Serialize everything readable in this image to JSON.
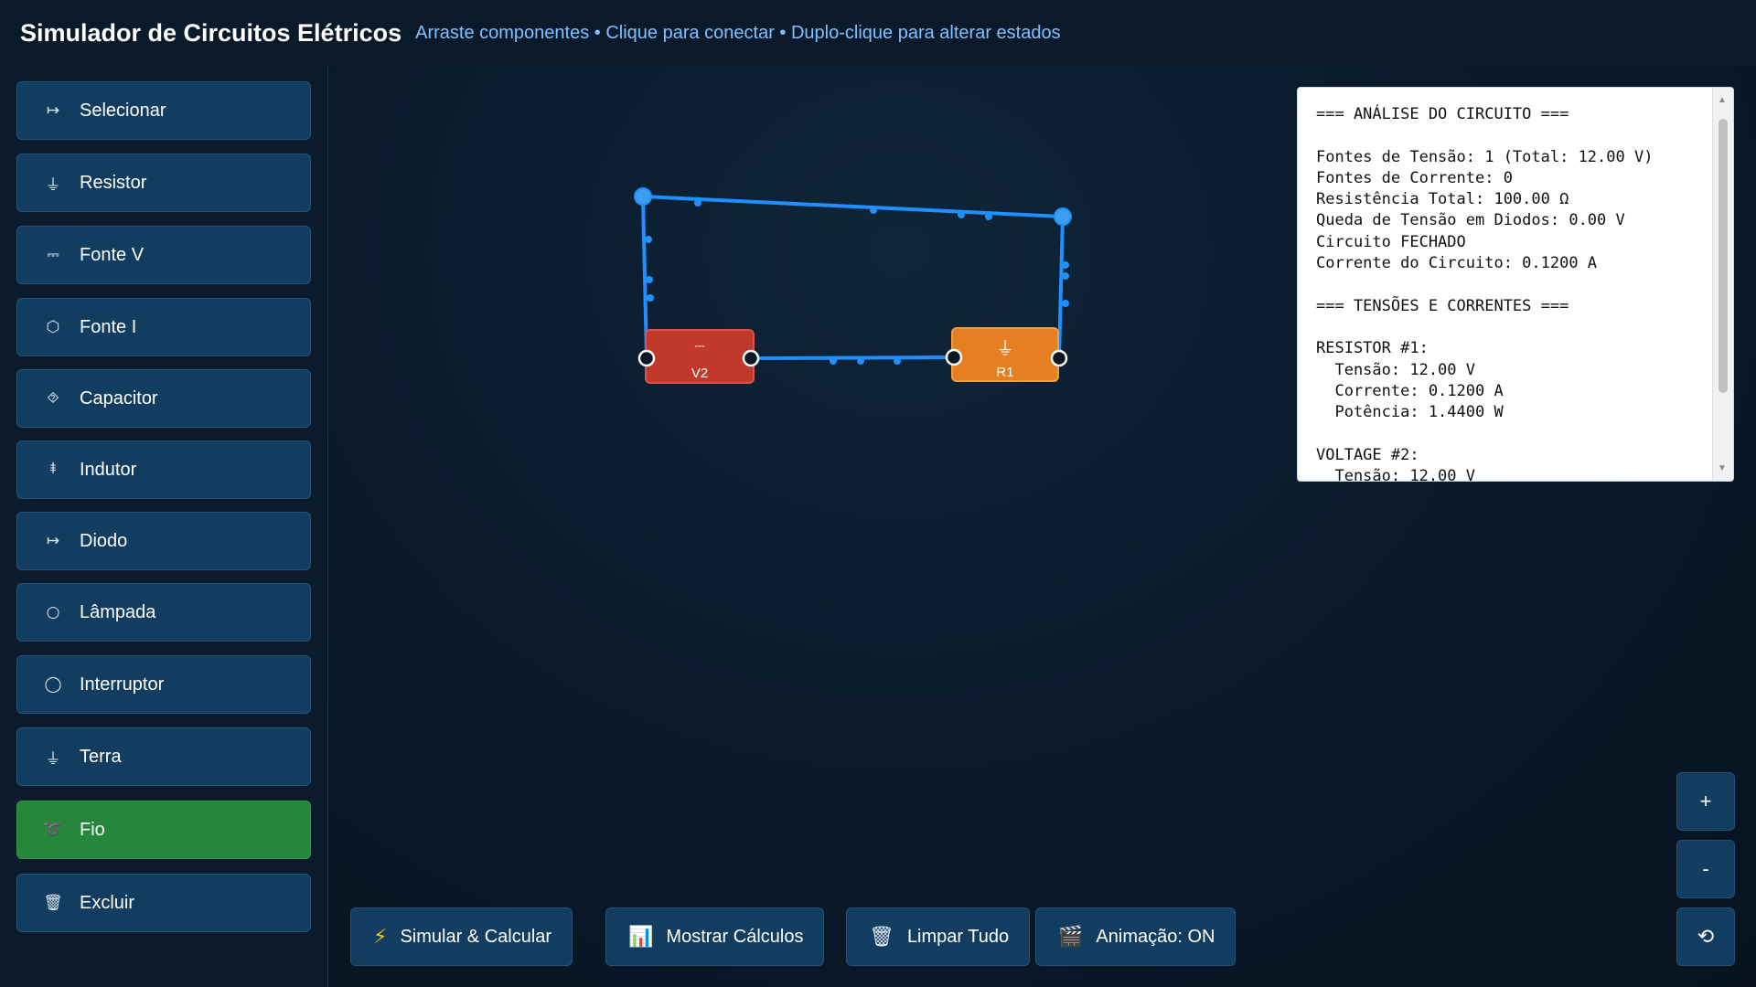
{
  "header": {
    "title": "Simulador de Circuitos Elétricos",
    "subtitle": "Arraste componentes • Clique para conectar • Duplo-clique para alterar estados"
  },
  "tools": [
    {
      "label": "Selecionar",
      "icon": "↦",
      "icon_name": "arrow-icon"
    },
    {
      "label": "Resistor",
      "icon": "⏚",
      "icon_name": "ground-icon"
    },
    {
      "label": "Fonte V",
      "icon": "⎓",
      "icon_name": "dc-icon"
    },
    {
      "label": "Fonte I",
      "icon": "⬡",
      "icon_name": "hexagon-icon"
    },
    {
      "label": "Capacitor",
      "icon": "⯑",
      "icon_name": "capacitor-icon"
    },
    {
      "label": "Indutor",
      "icon": "⯒",
      "icon_name": "inductor-icon"
    },
    {
      "label": "Diodo",
      "icon": "↦",
      "icon_name": "arrow-icon"
    },
    {
      "label": "Lâmpada",
      "icon": "○",
      "icon_name": "circle-icon"
    },
    {
      "label": "Interruptor",
      "icon": "◯",
      "icon_name": "large-circle-icon"
    },
    {
      "label": "Terra",
      "icon": "⏚",
      "icon_name": "ground-icon"
    },
    {
      "label": "Fio",
      "icon": "➰",
      "icon_name": "loop-icon",
      "active": true
    },
    {
      "label": "Excluir",
      "icon": "🗑",
      "icon_name": "trash-icon"
    }
  ],
  "circuit": {
    "components": [
      {
        "label": "V2",
        "type": "voltage-source",
        "color": "#c0392b",
        "symbol": "⎓"
      },
      {
        "label": "R1",
        "type": "resistor",
        "color": "#e67e22",
        "symbol": "⏚"
      }
    ],
    "wire_color": "#1e90ff"
  },
  "analysis": {
    "lines": [
      "=== ANÁLISE DO CIRCUITO ===",
      "",
      "Fontes de Tensão: 1 (Total: 12.00 V)",
      "Fontes de Corrente: 0",
      "Resistência Total: 100.00 Ω",
      "Queda de Tensão em Diodos: 0.00 V",
      "Circuito FECHADO",
      "Corrente do Circuito: 0.1200 A",
      "",
      "=== TENSÕES E CORRENTES ===",
      "",
      "RESISTOR #1:",
      "  Tensão: 12.00 V",
      "  Corrente: 0.1200 A",
      "  Potência: 1.4400 W",
      "",
      "VOLTAGE #2:",
      "  Tensão: 12.00 V"
    ]
  },
  "bottom_buttons": [
    {
      "label": "Simular & Calcular",
      "icon": "⚡",
      "icon_name": "lightning-icon"
    },
    {
      "label": "Mostrar Cálculos",
      "icon": "📊",
      "icon_name": "chart-icon"
    },
    {
      "label": "Limpar Tudo",
      "icon": "🗑",
      "icon_name": "trash-icon"
    },
    {
      "label": "Animação: ON",
      "icon": "🎬",
      "icon_name": "clapper-icon"
    }
  ],
  "zoom": {
    "zoom_in": "+",
    "zoom_out": "-",
    "reset": "⟲"
  }
}
